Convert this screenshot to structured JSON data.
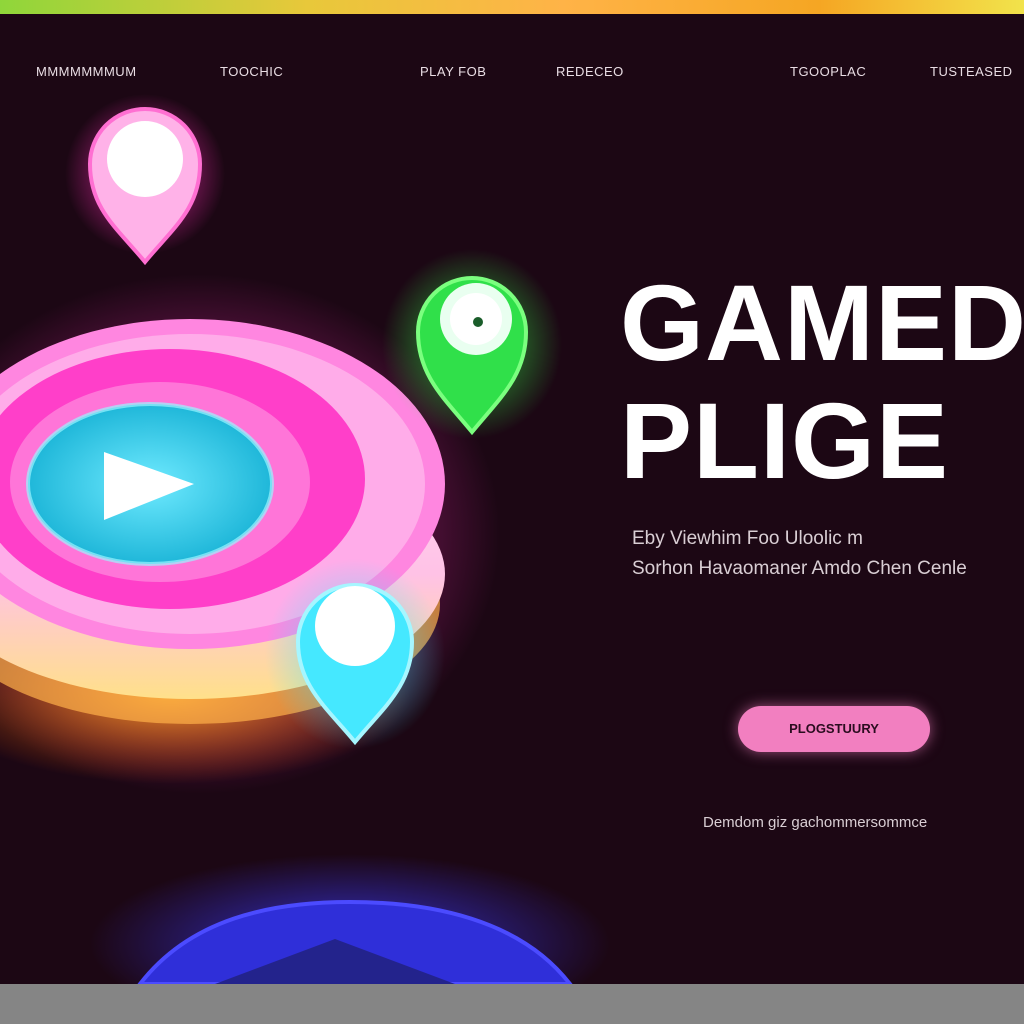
{
  "nav": {
    "items": [
      {
        "label": "MMMMMMMUM"
      },
      {
        "label": "TOOCHIC"
      },
      {
        "label": "PLAY FOB"
      },
      {
        "label": "REDECEO"
      },
      {
        "label": "TGOOPLAC"
      },
      {
        "label": "TUSTEASED"
      }
    ]
  },
  "hero": {
    "title_line1": "GAMED",
    "title_line2": "PLIGE",
    "subtitle_line1": "Eby Viewhim Foo Uloolic m",
    "subtitle_line2": "Sorhon Havaomaner Amdo Chen Cenle",
    "cta_label": "PLOGSTUURY",
    "footnote": "Demdom giz gachommersommce"
  },
  "colors": {
    "background": "#1c0714",
    "accent_pink": "#ff4fd8",
    "accent_cyan": "#3fe6ff",
    "accent_green": "#35ff4a",
    "cta": "#f27fc0",
    "text": "#ffffff"
  },
  "icons": {
    "play": "play-icon",
    "pins": [
      "location-pin-icon-pink",
      "location-pin-icon-green",
      "location-pin-icon-cyan"
    ]
  }
}
